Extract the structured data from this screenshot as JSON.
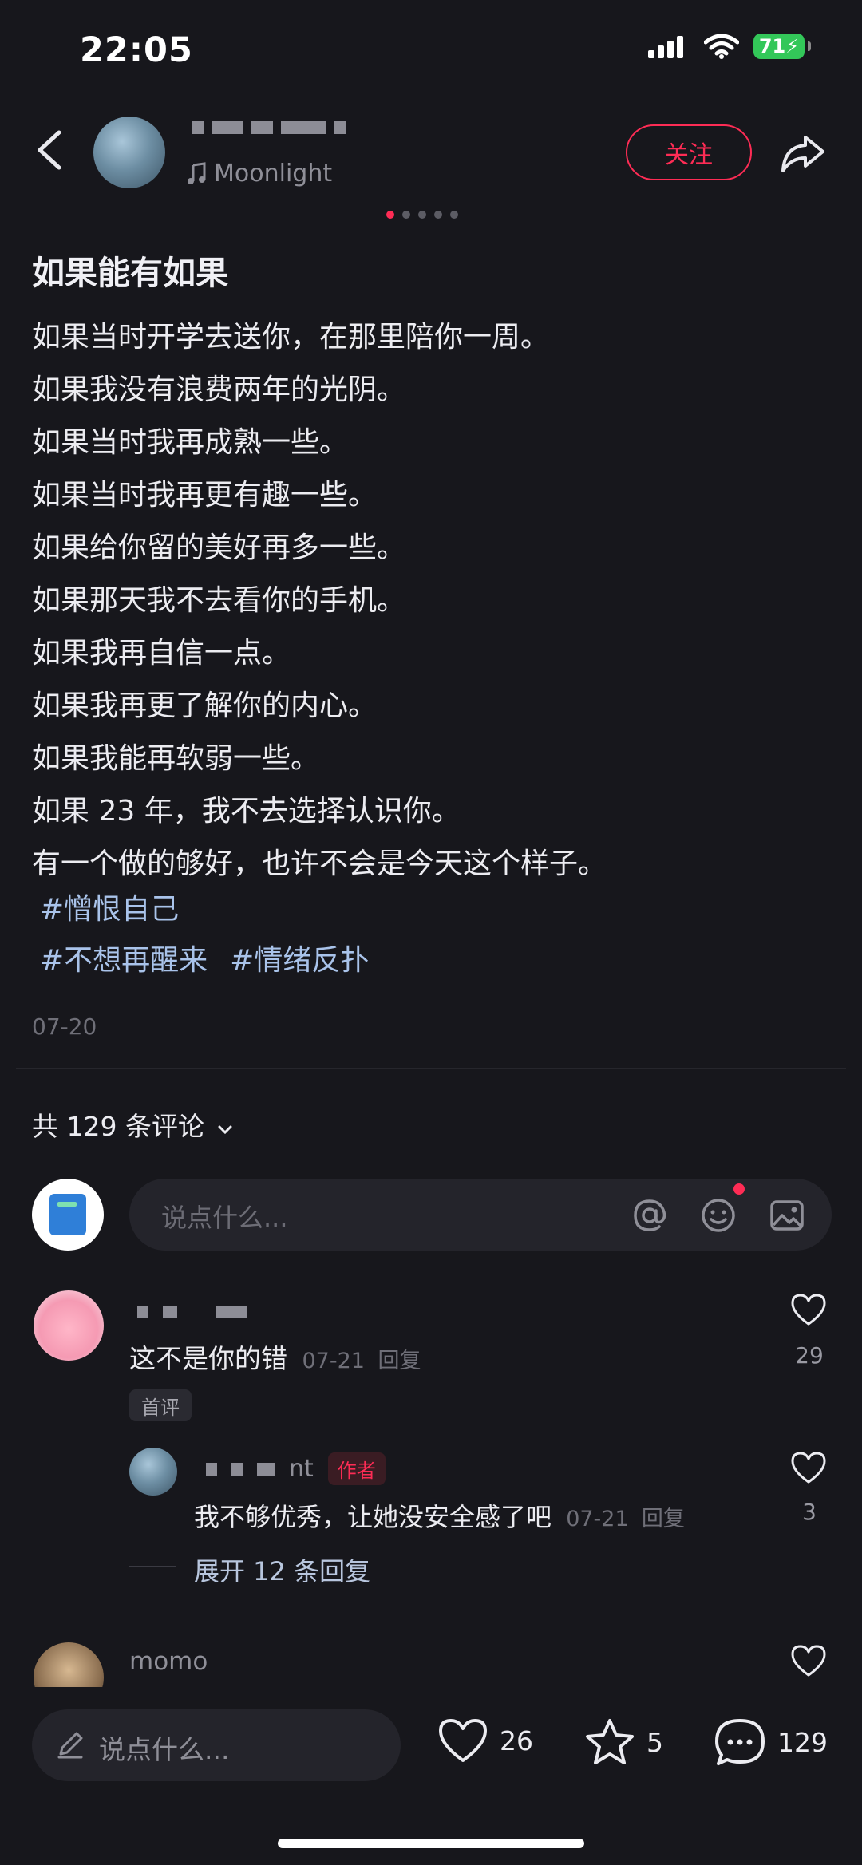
{
  "status_bar": {
    "time": "22:05",
    "battery": "71"
  },
  "header": {
    "song": "Moonlight",
    "follow_label": "关注"
  },
  "post": {
    "title": "如果能有如果",
    "lines": [
      "如果当时开学去送你，在那里陪你一周。",
      "如果我没有浪费两年的光阴。",
      "如果当时我再成熟一些。",
      "如果当时我再更有趣一些。",
      "如果给你留的美好再多一些。",
      "如果那天我不去看你的手机。",
      "如果我再自信一点。",
      "如果我再更了解你的内心。",
      "如果我能再软弱一些。",
      "如果 23 年，我不去选择认识你。",
      "有一个做的够好，也许不会是今天这个样子。"
    ],
    "tags": [
      "#憎恨自己",
      "#不想再醒来",
      "#情绪反扑"
    ],
    "date": "07-20"
  },
  "comments_header": "共 129 条评论",
  "comment_input_placeholder": "说点什么...",
  "comments": [
    {
      "text": "这不是你的错",
      "date": "07-21",
      "reply": "回复",
      "badge": "首评",
      "likes": "29"
    },
    {
      "name_suffix": "nt",
      "author_badge": "作者",
      "text": "我不够优秀，让她没安全感了吧",
      "date": "07-21",
      "reply": "回复",
      "likes": "3"
    },
    {
      "name": "momo"
    }
  ],
  "expand_replies": "展开 12 条回复",
  "bottom_bar": {
    "placeholder": "说点什么...",
    "likes": "26",
    "stars": "5",
    "comments": "129"
  }
}
